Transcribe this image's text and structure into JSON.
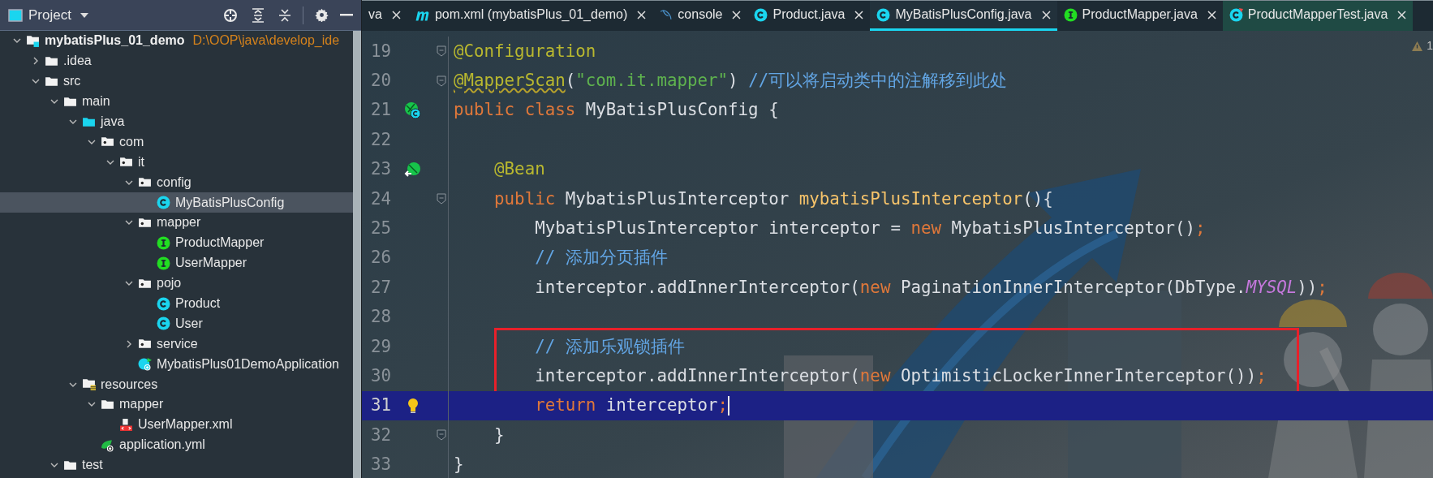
{
  "project_panel": {
    "title": "Project",
    "tree": [
      {
        "name": "mybatisPlus_01_demo",
        "path": "D:\\OOP\\java\\develop_ide",
        "kind": "module",
        "expanded": true,
        "selected": false,
        "children": [
          {
            "name": ".idea",
            "kind": "folder",
            "expanded": false,
            "selected": false
          },
          {
            "name": "src",
            "kind": "folder",
            "expanded": true,
            "selected": false,
            "children": [
              {
                "name": "main",
                "kind": "folder",
                "expanded": true,
                "selected": false,
                "children": [
                  {
                    "name": "java",
                    "kind": "source-folder",
                    "expanded": true,
                    "selected": false,
                    "children": [
                      {
                        "name": "com",
                        "kind": "package",
                        "expanded": true,
                        "selected": false,
                        "children": [
                          {
                            "name": "it",
                            "kind": "package",
                            "expanded": true,
                            "selected": false,
                            "children": [
                              {
                                "name": "config",
                                "kind": "package",
                                "expanded": true,
                                "selected": false,
                                "children": [
                                  {
                                    "name": "MyBatisPlusConfig",
                                    "kind": "class",
                                    "selected": true
                                  }
                                ]
                              },
                              {
                                "name": "mapper",
                                "kind": "package",
                                "expanded": true,
                                "selected": false,
                                "children": [
                                  {
                                    "name": "ProductMapper",
                                    "kind": "interface",
                                    "selected": false
                                  },
                                  {
                                    "name": "UserMapper",
                                    "kind": "interface",
                                    "selected": false
                                  }
                                ]
                              },
                              {
                                "name": "pojo",
                                "kind": "package",
                                "expanded": true,
                                "selected": false,
                                "children": [
                                  {
                                    "name": "Product",
                                    "kind": "class",
                                    "selected": false
                                  },
                                  {
                                    "name": "User",
                                    "kind": "class",
                                    "selected": false
                                  }
                                ]
                              },
                              {
                                "name": "service",
                                "kind": "package",
                                "expanded": false,
                                "selected": false
                              },
                              {
                                "name": "MybatisPlus01DemoApplication",
                                "kind": "boot-class",
                                "selected": false
                              }
                            ]
                          }
                        ]
                      }
                    ]
                  },
                  {
                    "name": "resources",
                    "kind": "resources-folder",
                    "expanded": true,
                    "selected": false,
                    "children": [
                      {
                        "name": "mapper",
                        "kind": "folder",
                        "expanded": true,
                        "selected": false,
                        "children": [
                          {
                            "name": "UserMapper.xml",
                            "kind": "xml",
                            "selected": false
                          }
                        ]
                      },
                      {
                        "name": "application.yml",
                        "kind": "yml",
                        "selected": false
                      }
                    ]
                  }
                ]
              },
              {
                "name": "test",
                "kind": "folder",
                "expanded": true,
                "selected": false
              }
            ]
          }
        ]
      }
    ]
  },
  "editor": {
    "tabs": [
      {
        "label": "va",
        "kind": "none",
        "selected": false
      },
      {
        "label": "pom.xml (mybatisPlus_01_demo)",
        "kind": "maven",
        "selected": false
      },
      {
        "label": "console",
        "kind": "database",
        "selected": false
      },
      {
        "label": "Product.java",
        "kind": "class",
        "selected": false
      },
      {
        "label": "MyBatisPlusConfig.java",
        "kind": "class",
        "selected": true
      },
      {
        "label": "ProductMapper.java",
        "kind": "interface",
        "selected": false
      },
      {
        "label": "ProductMapperTest.java",
        "kind": "test-class",
        "selected": false
      }
    ],
    "warning_count": "1",
    "lines": [
      {
        "number": "19",
        "kind": "fold",
        "current": false,
        "boxed": false,
        "tokens": [
          {
            "kind": "annotation",
            "text": "@Configuration"
          }
        ]
      },
      {
        "number": "20",
        "kind": "fold",
        "current": false,
        "boxed": false,
        "tokens": [
          {
            "kind": "annotation-warn",
            "text": "@MapperScan"
          },
          {
            "kind": "plain",
            "text": "("
          },
          {
            "kind": "string",
            "text": "\"com.it.mapper\""
          },
          {
            "kind": "plain",
            "text": ") "
          },
          {
            "kind": "comment",
            "text": "//可以将启动类中的注解移到此处"
          }
        ]
      },
      {
        "number": "21",
        "kind": "spring-class",
        "current": false,
        "boxed": false,
        "tokens": [
          {
            "kind": "keyword",
            "text": "public class"
          },
          {
            "kind": "plain",
            "text": " MyBatisPlusConfig {"
          }
        ]
      },
      {
        "number": "22",
        "kind": "none",
        "current": false,
        "boxed": false
      },
      {
        "number": "23",
        "kind": "bean",
        "current": false,
        "boxed": false,
        "tokens": [
          {
            "kind": "annotation",
            "text": "    @Bean"
          }
        ]
      },
      {
        "number": "24",
        "kind": "fold",
        "current": false,
        "boxed": false,
        "tokens": [
          {
            "kind": "keyword",
            "text": "    public"
          },
          {
            "kind": "plain",
            "text": " MybatisPlusInterceptor "
          },
          {
            "kind": "method",
            "text": "mybatisPlusInterceptor"
          },
          {
            "kind": "plain",
            "text": "(){"
          }
        ]
      },
      {
        "number": "25",
        "kind": "none",
        "current": false,
        "boxed": false,
        "tokens": [
          {
            "kind": "plain",
            "text": "        MybatisPlusInterceptor interceptor = "
          },
          {
            "kind": "keyword",
            "text": "new"
          },
          {
            "kind": "plain",
            "text": " MybatisPlusInterceptor()"
          },
          {
            "kind": "keyword",
            "text": ";"
          }
        ]
      },
      {
        "number": "26",
        "kind": "none",
        "current": false,
        "boxed": false,
        "tokens": [
          {
            "kind": "comment",
            "text": "        // 添加分页插件"
          }
        ]
      },
      {
        "number": "27",
        "kind": "none",
        "current": false,
        "boxed": false,
        "tokens": [
          {
            "kind": "plain",
            "text": "        interceptor.addInnerInterceptor("
          },
          {
            "kind": "keyword",
            "text": "new"
          },
          {
            "kind": "plain",
            "text": " PaginationInnerInterceptor(DbType."
          },
          {
            "kind": "constant",
            "text": "MYSQL"
          },
          {
            "kind": "plain",
            "text": "))"
          },
          {
            "kind": "keyword",
            "text": ";"
          }
        ]
      },
      {
        "number": "28",
        "kind": "none",
        "current": false,
        "boxed": false
      },
      {
        "number": "29",
        "kind": "none",
        "current": false,
        "boxed": true,
        "tokens": [
          {
            "kind": "comment",
            "text": "        // 添加乐观锁插件"
          }
        ]
      },
      {
        "number": "30",
        "kind": "none",
        "current": false,
        "boxed": true,
        "tokens": [
          {
            "kind": "plain",
            "text": "        interceptor.addInnerInterceptor("
          },
          {
            "kind": "keyword",
            "text": "new"
          },
          {
            "kind": "plain",
            "text": " OptimisticLockerInnerInterceptor())"
          },
          {
            "kind": "keyword",
            "text": ";"
          }
        ]
      },
      {
        "number": "31",
        "kind": "bulb",
        "current": true,
        "boxed": false,
        "caret": true,
        "tokens": [
          {
            "kind": "keyword",
            "text": "        return"
          },
          {
            "kind": "plain",
            "text": " interceptor"
          },
          {
            "kind": "keyword",
            "text": ";"
          }
        ]
      },
      {
        "number": "32",
        "kind": "fold",
        "current": false,
        "boxed": false,
        "tokens": [
          {
            "kind": "plain",
            "text": "    }"
          }
        ]
      },
      {
        "number": "33",
        "kind": "none",
        "current": false,
        "boxed": false,
        "tokens": [
          {
            "kind": "plain",
            "text": "}"
          }
        ]
      }
    ]
  }
}
